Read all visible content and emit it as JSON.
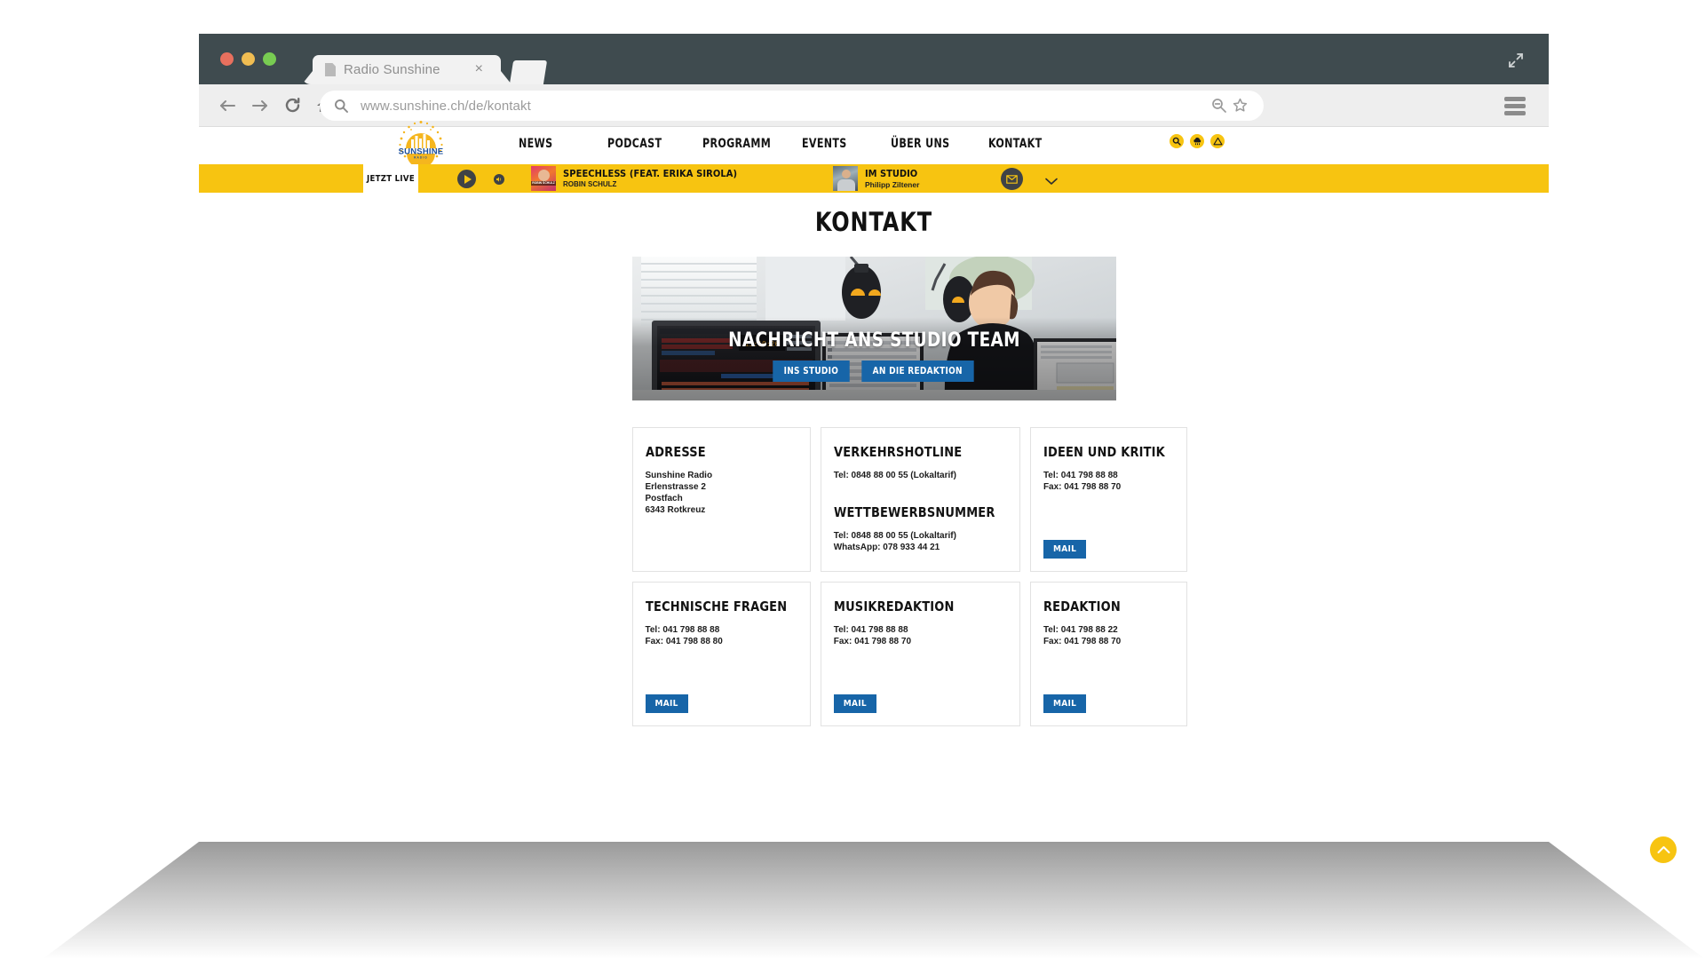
{
  "browser": {
    "tab_title": "Radio Sunshine",
    "tab_close": "×",
    "url": "www.sunshine.ch/de/kontakt",
    "icons": {
      "back": "back-arrow-icon",
      "forward": "forward-arrow-icon",
      "reload": "reload-icon",
      "home": "home-icon",
      "search": "search-icon",
      "zoom_out": "zoom-out-icon",
      "bookmark": "star-icon",
      "menu": "hamburger-menu-icon",
      "expand": "expand-fullscreen-icon",
      "new_tab": "new-tab-button"
    }
  },
  "site": {
    "logo": {
      "name": "SUNSHINE",
      "sub": "RADIO"
    },
    "nav": [
      {
        "label": "NEWS"
      },
      {
        "label": "PODCAST"
      },
      {
        "label": "PROGRAMM"
      },
      {
        "label": "EVENTS"
      },
      {
        "label": "ÜBER UNS"
      },
      {
        "label": "KONTAKT"
      }
    ],
    "nav_icons": [
      {
        "name": "search-icon",
        "glyph": "⚲"
      },
      {
        "name": "weather-cloud-icon",
        "glyph": "☁"
      },
      {
        "name": "traffic-warning-icon",
        "glyph": "△"
      }
    ]
  },
  "player": {
    "live_label": "JETZT LIVE",
    "play_button": "play-button",
    "mute_button": "mute-button",
    "cover_caption": "ROBIN SCHULZ",
    "track_title": "SPEECHLESS (FEAT. ERIKA SIROLA)",
    "track_artist": "ROBIN SCHULZ",
    "studio_label": "IM STUDIO",
    "studio_host": "Philipp Ziltener",
    "mail_button": "mail-button",
    "expand_button": "chevron-down-button"
  },
  "page": {
    "title": "KONTAKT",
    "hero": {
      "title": "NACHRICHT ANS STUDIO TEAM",
      "buttons": [
        {
          "label": "INS STUDIO"
        },
        {
          "label": "AN DIE REDAKTION"
        }
      ]
    },
    "cards": [
      {
        "heading": "ADRESSE",
        "lines": [
          "Sunshine Radio",
          "Erlenstrasse 2",
          "Postfach",
          "6343 Rotkreuz"
        ],
        "heading2": "",
        "lines2": [],
        "button": ""
      },
      {
        "heading": "VERKEHRSHOTLINE",
        "lines": [
          "Tel: 0848 88 00 55 (Lokaltarif)"
        ],
        "heading2": "WETTBEWERBSNUMMER",
        "lines2": [
          "Tel: 0848 88 00 55 (Lokaltarif)",
          "WhatsApp: 078 933 44 21"
        ],
        "button": ""
      },
      {
        "heading": "IDEEN UND KRITIK",
        "lines": [
          "Tel: 041 798 88 88",
          "Fax: 041 798 88 70"
        ],
        "heading2": "",
        "lines2": [],
        "button": "MAIL"
      },
      {
        "heading": "TECHNISCHE FRAGEN",
        "lines": [
          "Tel: 041 798 88 88",
          "Fax: 041 798 88 80"
        ],
        "heading2": "",
        "lines2": [],
        "button": "MAIL"
      },
      {
        "heading": "MUSIKREDAKTION",
        "lines": [
          "Tel: 041 798 88 88",
          "Fax: 041 798 88 70"
        ],
        "heading2": "",
        "lines2": [],
        "button": "MAIL"
      },
      {
        "heading": "REDAKTION",
        "lines": [
          "Tel: 041 798 88 22",
          "Fax: 041 798 88 70"
        ],
        "heading2": "",
        "lines2": [],
        "button": "MAIL"
      }
    ],
    "scroll_top": "scroll-to-top-button"
  },
  "colors": {
    "brand_yellow": "#f7c411",
    "brand_blue": "#1765a8",
    "logo_blue": "#1c4f9c",
    "chrome_dark": "#3f4b4f"
  }
}
